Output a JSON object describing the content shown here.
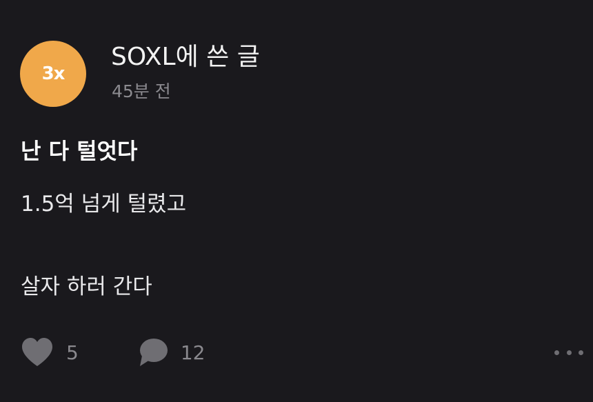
{
  "post": {
    "avatar_text": "3x",
    "board_name": "SOXL에 쓴 글",
    "timestamp": "45분 전",
    "title": "난 다 털엇다",
    "body_lines": [
      "1.5억 넘게 털렸고",
      "",
      "살자 하러 간다"
    ],
    "likes": "5",
    "comments": "12"
  },
  "icons": {
    "like": "heart-icon",
    "comment": "speech-bubble-icon",
    "more": "more-dots-icon"
  },
  "colors": {
    "background": "#1a191d",
    "avatar": "#f0a84a",
    "muted_text": "#8b8a8f",
    "icon": "#6f6e73"
  }
}
